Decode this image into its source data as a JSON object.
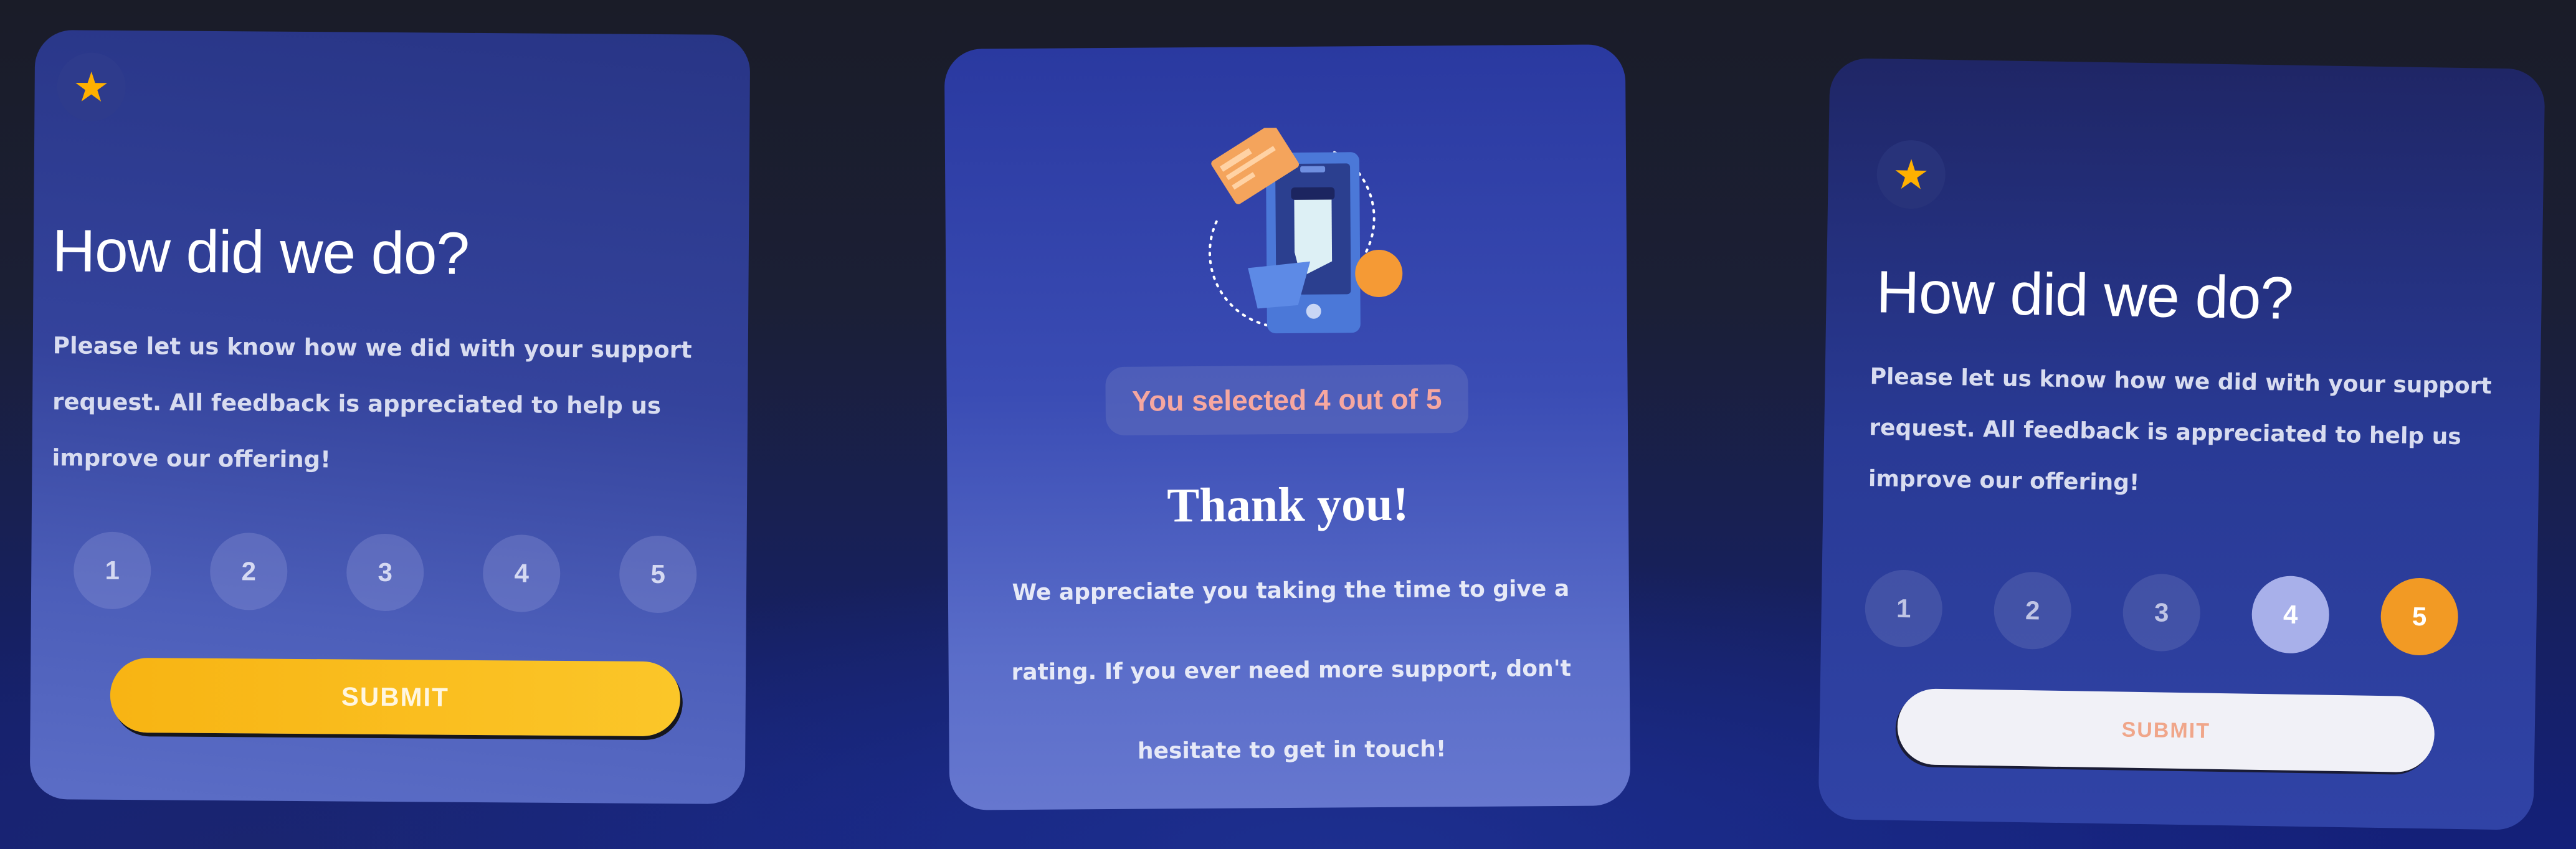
{
  "rating_card_default": {
    "title": "How did we do?",
    "description": "Please let us know how we did with your support request. All feedback is appreciated to help us improve our offering!",
    "ratings": [
      "1",
      "2",
      "3",
      "4",
      "5"
    ],
    "submit_label": "SUBMIT"
  },
  "thank_you_card": {
    "selected_text": "You selected 4 out of 5",
    "title": "Thank you!",
    "description": "We appreciate you taking the time to give a rating. If you ever need more support, don't hesitate to get in touch!"
  },
  "rating_card_selected": {
    "title": "How did we do?",
    "description": "Please let us know how we did with your support request. All feedback is appreciated to help us improve our offering!",
    "ratings": [
      "1",
      "2",
      "3",
      "4",
      "5"
    ],
    "submit_label": "SUBMIT"
  },
  "colors": {
    "accent_orange": "#f29a24",
    "star_gold": "#ffb000",
    "submit_yellow": "#fbc629",
    "selected_pill_text": "#f6a7a0"
  },
  "icons": {
    "star": "star-icon",
    "illustration": "phone-payment-illustration"
  }
}
